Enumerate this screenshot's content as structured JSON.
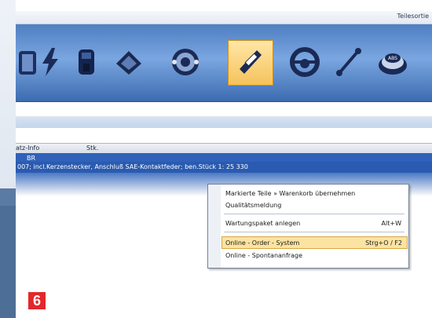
{
  "window": {
    "title": "Teilesortie"
  },
  "toolbar": {
    "icons": [
      {
        "name": "filter-icon"
      },
      {
        "name": "ignition-bolt-icon"
      },
      {
        "name": "ignition-coil-icon"
      },
      {
        "name": "brake-pad-icon"
      },
      {
        "name": "bearing-icon"
      },
      {
        "name": "shock-absorber-icon"
      },
      {
        "name": "steering-wheel-icon"
      },
      {
        "name": "tie-rod-icon"
      },
      {
        "name": "abs-disc-icon"
      }
    ],
    "active_color": "#f5c25c"
  },
  "table": {
    "columns": [
      "atz-Info",
      "Stk."
    ],
    "selected_row_label": "BR",
    "selected_row_text": "007; incl.Kerzenstecker, Anschluß SAE-Kontaktfeder; ben.Stück 1: 25 330"
  },
  "context_menu": {
    "items": [
      {
        "label": "Markierte Teile » Warenkorb übernehmen",
        "shortcut": ""
      },
      {
        "label": "Qualitätsmeldung",
        "shortcut": ""
      },
      {
        "label": "Wartungspaket anlegen",
        "shortcut": "Alt+W"
      },
      {
        "label": "Online - Order - System",
        "shortcut": "Strg+O / F2"
      },
      {
        "label": "Online - Spontananfrage",
        "shortcut": ""
      }
    ]
  },
  "badge": {
    "label": "6"
  },
  "colors": {
    "selection": "#2f62b8",
    "highlight": "#fbe3a1",
    "badge": "#e2282a"
  }
}
